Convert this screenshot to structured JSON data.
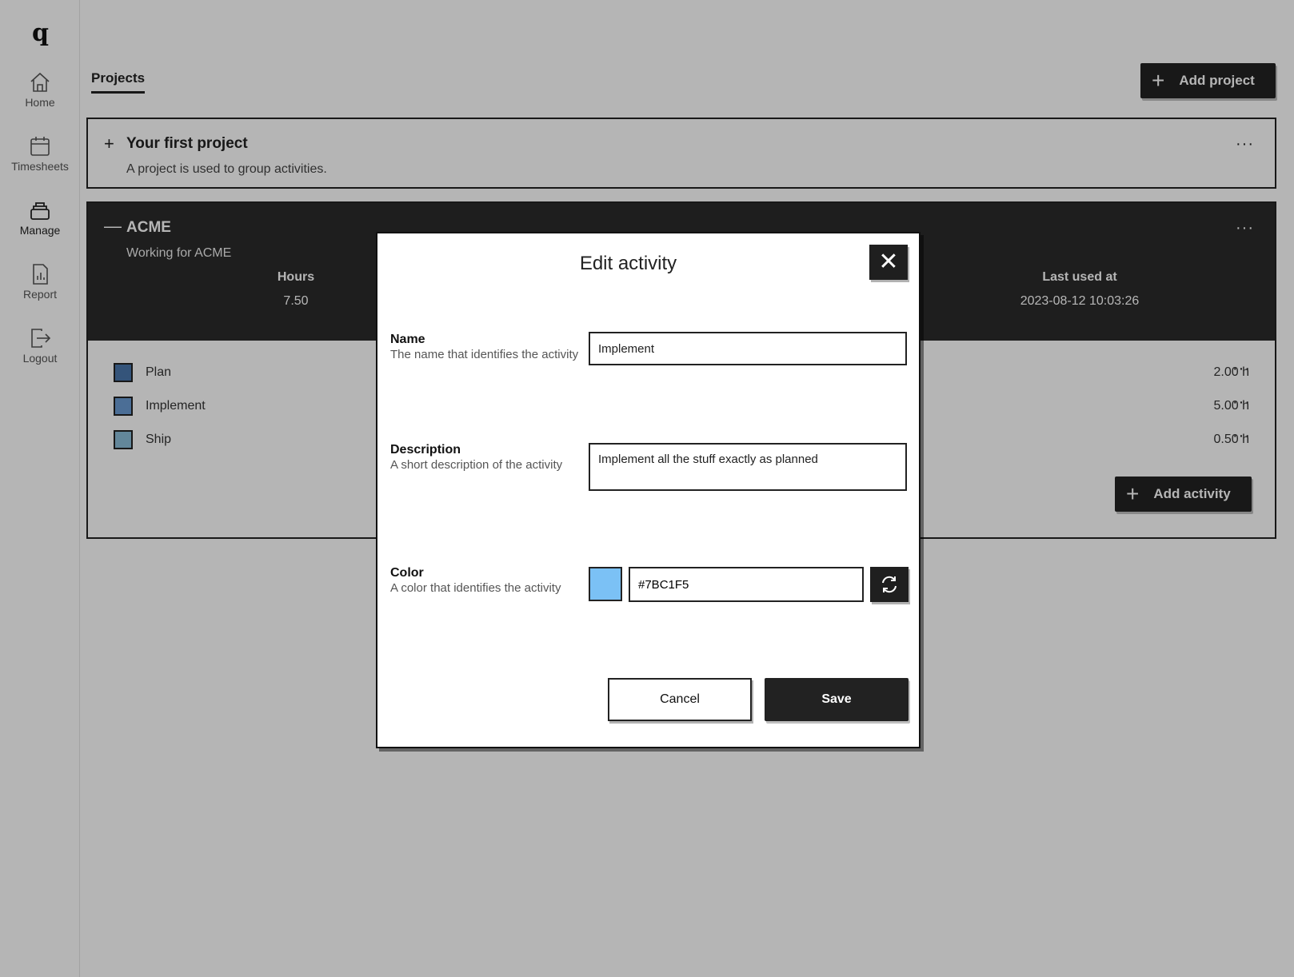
{
  "app": {
    "logo": "q"
  },
  "sidebar": {
    "items": [
      {
        "label": "Home",
        "icon": "home-icon"
      },
      {
        "label": "Timesheets",
        "icon": "calendar-icon"
      },
      {
        "label": "Manage",
        "icon": "stack-icon"
      },
      {
        "label": "Report",
        "icon": "report-icon"
      },
      {
        "label": "Logout",
        "icon": "logout-icon"
      }
    ]
  },
  "header": {
    "tab": "Projects",
    "add_project_label": "Add project"
  },
  "projects": [
    {
      "toggle": "+",
      "name": "Your first project",
      "description": "A project is used to group activities.",
      "menu": "···"
    },
    {
      "toggle": "—",
      "name": "ACME",
      "description": "Working for ACME",
      "menu": "···",
      "stats": [
        {
          "label": "Hours",
          "value": "7.50"
        },
        {
          "label": "Last used at",
          "value": "2023-08-12 10:03:26"
        }
      ],
      "activities": [
        {
          "name": "Plan",
          "hours": "2.00 h",
          "color": "#4a77ad"
        },
        {
          "name": "Implement",
          "hours": "5.00 h",
          "color": "#6a9bd4"
        },
        {
          "name": "Ship",
          "hours": "0.50 h",
          "color": "#8cbfd9"
        }
      ],
      "add_activity_label": "Add activity"
    }
  ],
  "modal": {
    "title": "Edit activity",
    "close_icon": "close-icon",
    "name_label": "Name",
    "name_help": "The name that identifies the activity",
    "name_value": "Implement",
    "description_label": "Description",
    "description_help": "A short description of the activity",
    "description_value": "Implement all the stuff exactly as planned",
    "color_label": "Color",
    "color_help": "A color that identifies the activity",
    "color_value": "#7BC1F5",
    "refresh_icon": "refresh-icon",
    "cancel_label": "Cancel",
    "save_label": "Save"
  }
}
